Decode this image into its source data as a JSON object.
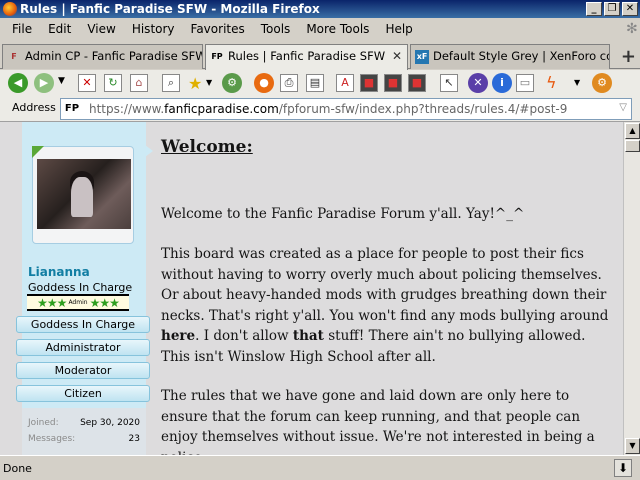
{
  "window": {
    "title": "Rules | Fanfic Paradise SFW - Mozilla Firefox"
  },
  "menu": [
    "File",
    "Edit",
    "View",
    "History",
    "Favorites",
    "Tools",
    "More Tools",
    "Help"
  ],
  "tabs": [
    {
      "label": "Admin CP - Fanfic Paradise SFW",
      "icon": "F"
    },
    {
      "label": "Rules | Fanfic Paradise SFW",
      "icon": "FP"
    },
    {
      "label": "Default Style Grey | XenForo co...",
      "icon": "xF"
    }
  ],
  "address": {
    "label": "Address",
    "url_prefix": "https://www.",
    "url_domain": "fanficparadise.com",
    "url_path": "/fpforum-sfw/index.php?threads/rules.4/#post-9",
    "favicon": "FP"
  },
  "user": {
    "name": "Liananna",
    "title": "Goddess In Charge",
    "star_label": "Admin",
    "badges": [
      "Goddess In Charge",
      "Administrator",
      "Moderator",
      "Citizen"
    ],
    "joined_label": "Joined:",
    "joined_value": "Sep 30, 2020",
    "messages_label": "Messages:",
    "messages_value": "23"
  },
  "post": {
    "heading": "Welcome:",
    "p1": "Welcome to the Fanfic Paradise Forum y'all. Yay!^_^",
    "p2a": "This board was created as a place for people to post their fics without having to worry overly much about policing themselves. Or about heavy-handed mods with grudges breathing down their necks. That's right y'all. You won't find any mods bullying around ",
    "p2b": "here",
    "p2c": ". I don't allow ",
    "p2d": "that",
    "p2e": " stuff! There ain't no bullying allowed. This isn't Winslow High School after all.",
    "p3": "The rules that we have gone and laid down are only here to ensure that the forum can keep running, and that people can enjoy themselves without issue. We're not interested in being a police"
  },
  "status": {
    "text": "Done"
  }
}
